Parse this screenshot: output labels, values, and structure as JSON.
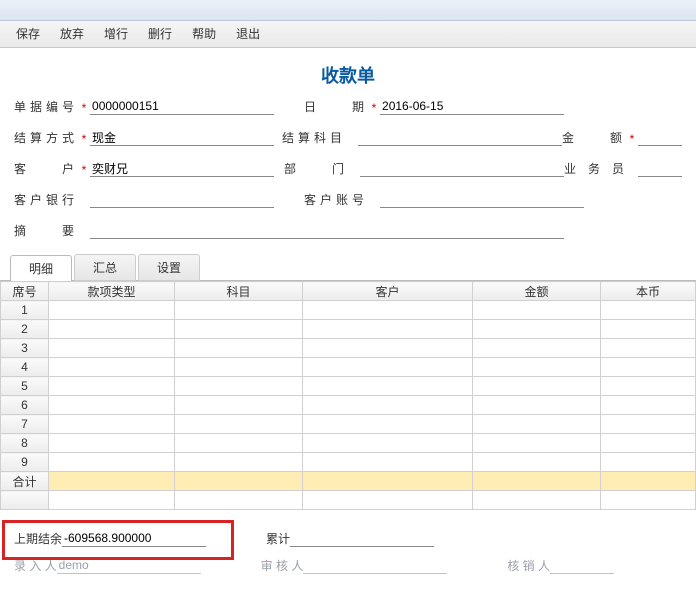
{
  "menu": {
    "save": "保存",
    "discard": "放弃",
    "addrow": "增行",
    "delrow": "删行",
    "help": "帮助",
    "exit": "退出"
  },
  "title": "收款单",
  "fields": {
    "doc_no_label": "单据编号",
    "doc_no": "0000000151",
    "date_label": "日  期",
    "date": "2016-06-15",
    "settle_label": "结算方式",
    "settle": "现金",
    "subject_label": "结算科目",
    "subject": "",
    "amount_label": "金  额",
    "amount": "",
    "cust_label": "客  户",
    "cust": "奕财兄",
    "dept_label": "部  门",
    "dept": "",
    "sales_label": "业 务 员",
    "sales": "",
    "bank_label": "客户银行",
    "bank": "",
    "acct_label": "客户账号",
    "acct": "",
    "memo_label": "摘  要",
    "memo": ""
  },
  "tabs": {
    "detail": "明细",
    "summary": "汇总",
    "settings": "设置"
  },
  "grid": {
    "cols": {
      "seq": "席号",
      "paytype": "款项类型",
      "subject": "科目",
      "cust": "客户",
      "amount": "金额",
      "base": "本币"
    },
    "rows": [
      "1",
      "2",
      "3",
      "4",
      "5",
      "6",
      "7",
      "8",
      "9"
    ],
    "total_label": "合计"
  },
  "footer": {
    "prev_label": "上期结余",
    "prev_val": "-609568.900000",
    "cum_label": "累计",
    "cum_val": "",
    "entry_label": "录 入 人",
    "entry_val": "demo",
    "audit_label": "审 核 人",
    "audit_val": "",
    "cancel_label": "核 销 人",
    "cancel_val": ""
  },
  "star": "*"
}
